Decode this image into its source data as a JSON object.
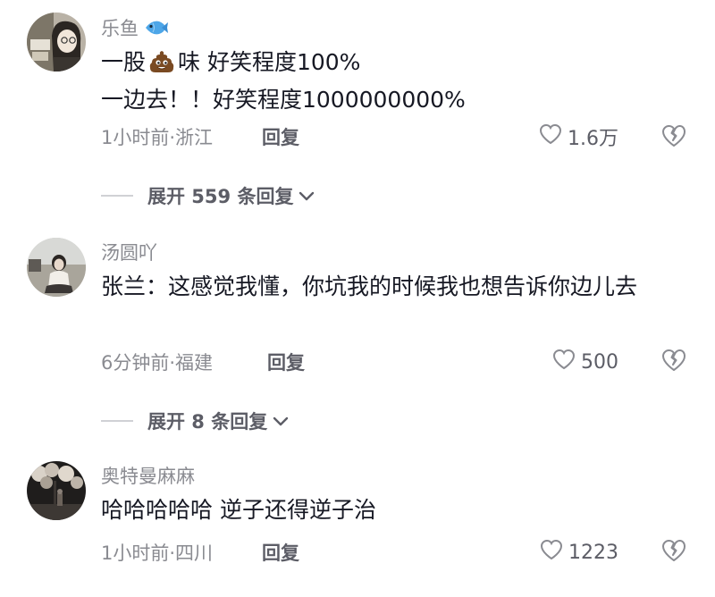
{
  "comments": [
    {
      "username": "乐鱼",
      "username_icon": "fish-icon",
      "content_before_emoji": "一股",
      "content_emoji": "poop-icon",
      "content_after_emoji": "味 好笑程度100%",
      "content_line2": "一边去！！好笑程度1000000000%",
      "meta": "1小时前·浙江",
      "reply_label": "回复",
      "likes": "1.6万",
      "expand_label": "展开 559 条回复"
    },
    {
      "username": "汤圆吖",
      "content": "张兰：这感觉我懂，你坑我的时候我也想告诉你边儿去",
      "meta": "6分钟前·福建",
      "reply_label": "回复",
      "likes": "500",
      "expand_label": "展开 8 条回复"
    },
    {
      "username": "奥特曼麻麻",
      "content": "哈哈哈哈哈 逆子还得逆子治",
      "meta": "1小时前·四川",
      "reply_label": "回复",
      "likes": "1223"
    }
  ]
}
